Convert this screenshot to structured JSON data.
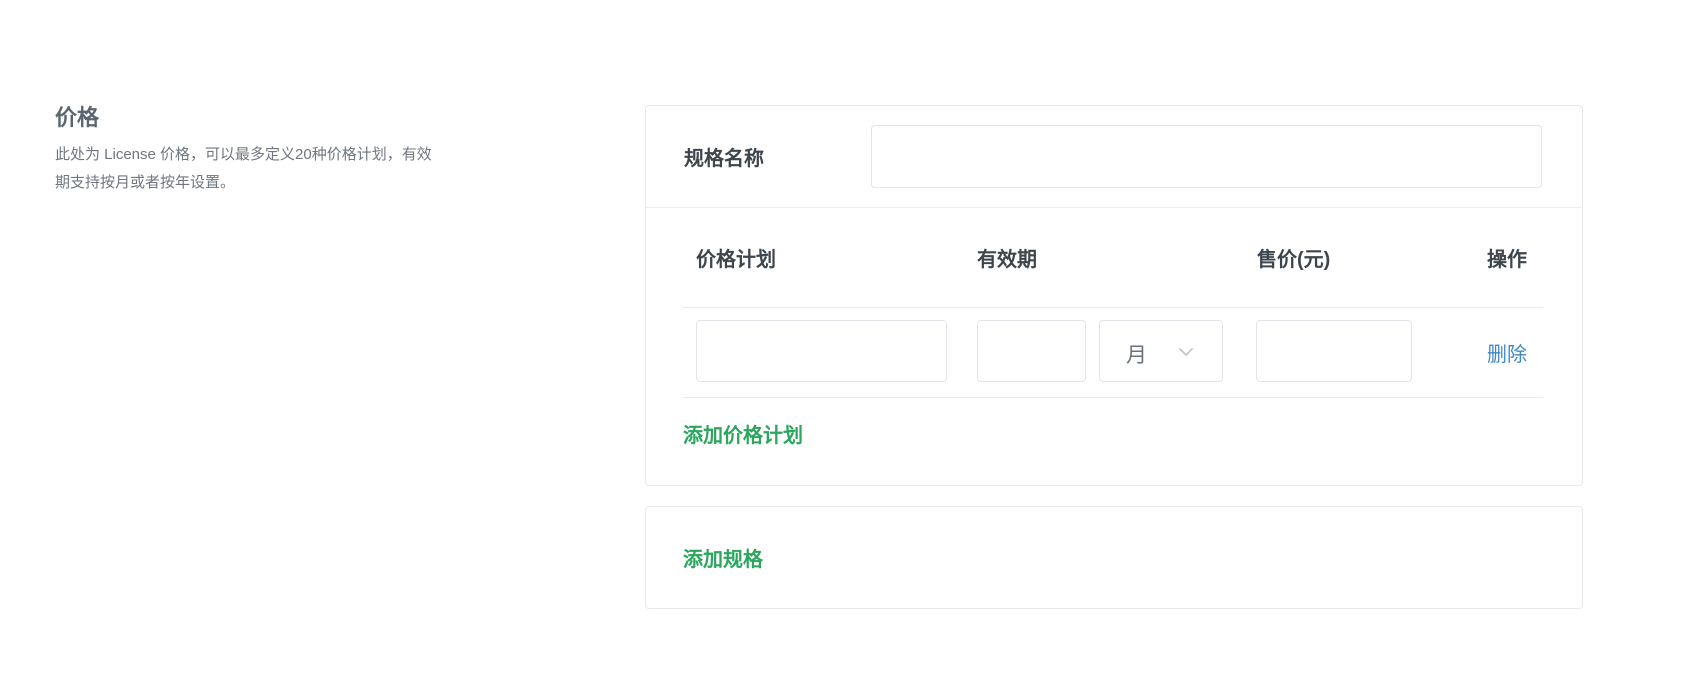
{
  "section": {
    "title": "价格",
    "description": "此处为 License 价格，可以最多定义20种价格计划，有效期支持按月或者按年设置。"
  },
  "spec": {
    "label": "规格名称",
    "input_value": ""
  },
  "table": {
    "headers": {
      "plan": "价格计划",
      "period": "有效期",
      "price": "售价(元)",
      "operation": "操作"
    },
    "rows": [
      {
        "plan_value": "",
        "period_value": "",
        "period_unit": "月",
        "price_value": "",
        "delete_label": "删除"
      }
    ]
  },
  "actions": {
    "add_plan": "添加价格计划",
    "add_spec": "添加规格"
  },
  "icons": {
    "select_arrow": "chevron-down-icon"
  },
  "colors": {
    "link_green": "#2aa65d",
    "link_blue": "#3e88c6"
  }
}
